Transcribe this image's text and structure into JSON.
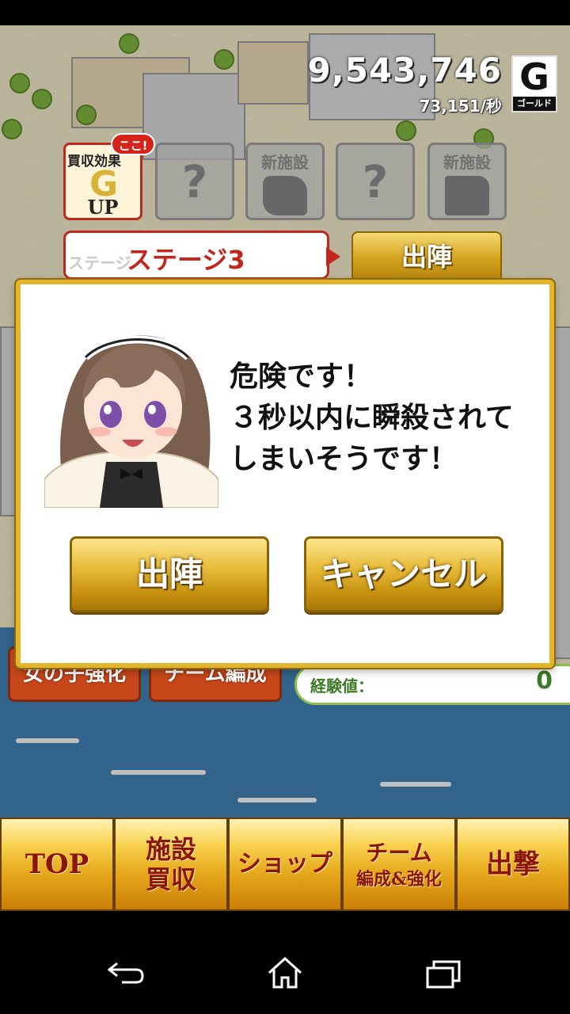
{
  "header": {
    "gold_amount": "9,543,746",
    "gold_rate": "73,151/秒",
    "gold_badge_letter": "G",
    "gold_badge_label": "ゴールド"
  },
  "facility_slots": {
    "active": {
      "line1": "買収効果",
      "letter": "G",
      "line2": "UP",
      "badge": "ここ!"
    },
    "locked_q": "?",
    "new_label": "新施設"
  },
  "stage": {
    "ghost_label": "ステージ",
    "label": "ステージ3",
    "sortie_label": "出陣"
  },
  "behind_buttons": {
    "girl_upgrade": "女の子強化",
    "team_formation": "チーム編成",
    "exp_label": "経験値：",
    "exp_value": "0"
  },
  "dialog": {
    "line1": "危険です！",
    "line2": "３秒以内に瞬殺されて",
    "line3": "しまいそうです！",
    "confirm_label": "出陣",
    "cancel_label": "キャンセル"
  },
  "bottom_nav": {
    "top": "TOP",
    "facility_l1": "施設",
    "facility_l2": "買収",
    "shop": "ショップ",
    "team_l1": "チーム",
    "team_l2": "編成&強化",
    "attack": "出撃"
  },
  "colors": {
    "gold_accent": "#e2b52a",
    "stage_red": "#c2271d",
    "nav_text": "#8b1508"
  }
}
